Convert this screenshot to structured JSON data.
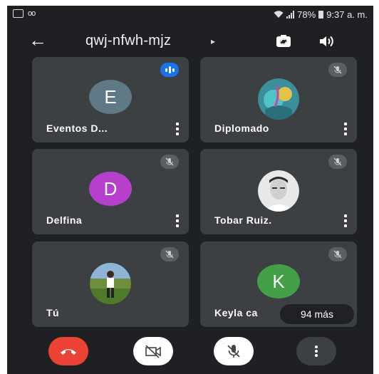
{
  "status_bar": {
    "left_text": "oo",
    "battery": "78%",
    "time": "9:37 a. m."
  },
  "header": {
    "back_icon": "arrow-back-icon",
    "meeting_code": "qwj-nfwh-mjz",
    "title_arrow": "▸",
    "switch_camera_icon": "switch-camera-icon",
    "speaker_icon": "speaker-icon"
  },
  "participants": [
    {
      "name": "Eventos D...",
      "initial": "E",
      "avatar_color": "#5f7a86",
      "state": "speaking"
    },
    {
      "name": "Diplomado",
      "initial": "",
      "avatar_color": "",
      "state": "muted"
    },
    {
      "name": "Delfina",
      "initial": "D",
      "avatar_color": "#b63fcb",
      "state": "muted"
    },
    {
      "name": "Tobar Ruiz.",
      "initial": "",
      "avatar_color": "",
      "state": "muted"
    },
    {
      "name": "Tú",
      "initial": "",
      "avatar_color": "",
      "state": "muted"
    },
    {
      "name": "Keyla ca",
      "initial": "K",
      "avatar_color": "#43a047",
      "state": "muted"
    }
  ],
  "more_participants": "94 más",
  "controls": {
    "end_call_color": "#ea4335",
    "end_call_icon": "phone-hangup-icon",
    "camera_icon": "camera-off-icon",
    "mic_icon": "mic-off-icon",
    "more_icon": "more-vert-icon"
  }
}
